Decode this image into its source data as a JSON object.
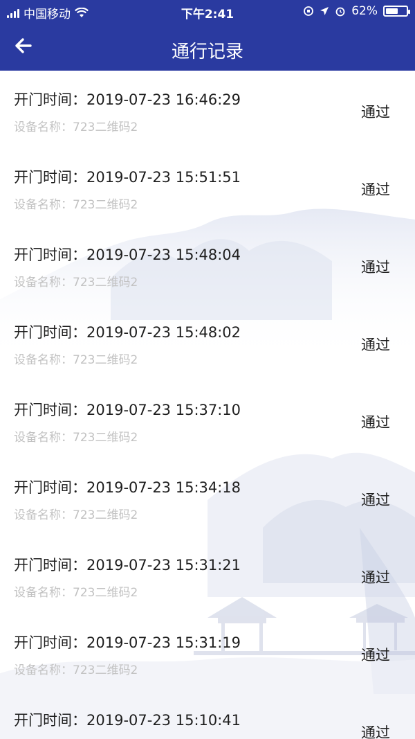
{
  "status_bar": {
    "carrier": "中国移动",
    "time": "下午2:41",
    "battery_percent": "62%",
    "battery_level": 0.62
  },
  "nav": {
    "title": "通行记录",
    "back_icon": "arrow-left-icon"
  },
  "records": [
    {
      "time_label": "开门时间：",
      "time": "2019-07-23 16:46:29",
      "device_label": "设备名称：",
      "device": "723二维码2",
      "status": "通过"
    },
    {
      "time_label": "开门时间：",
      "time": "2019-07-23 15:51:51",
      "device_label": "设备名称：",
      "device": "723二维码2",
      "status": "通过"
    },
    {
      "time_label": "开门时间：",
      "time": "2019-07-23 15:48:04",
      "device_label": "设备名称：",
      "device": "723二维码2",
      "status": "通过"
    },
    {
      "time_label": "开门时间：",
      "time": "2019-07-23 15:48:02",
      "device_label": "设备名称：",
      "device": "723二维码2",
      "status": "通过"
    },
    {
      "time_label": "开门时间：",
      "time": "2019-07-23 15:37:10",
      "device_label": "设备名称：",
      "device": "723二维码2",
      "status": "通过"
    },
    {
      "time_label": "开门时间：",
      "time": "2019-07-23 15:34:18",
      "device_label": "设备名称：",
      "device": "723二维码2",
      "status": "通过"
    },
    {
      "time_label": "开门时间：",
      "time": "2019-07-23 15:31:21",
      "device_label": "设备名称：",
      "device": "723二维码2",
      "status": "通过"
    },
    {
      "time_label": "开门时间：",
      "time": "2019-07-23 15:31:19",
      "device_label": "设备名称：",
      "device": "723二维码2",
      "status": "通过"
    },
    {
      "time_label": "开门时间：",
      "time": "2019-07-23 15:10:41",
      "device_label": "",
      "device": "",
      "status": "通过"
    }
  ],
  "colors": {
    "header": "#2a3aa0",
    "primary_text": "#1e1e1e",
    "secondary_text": "#c2c2c2"
  }
}
